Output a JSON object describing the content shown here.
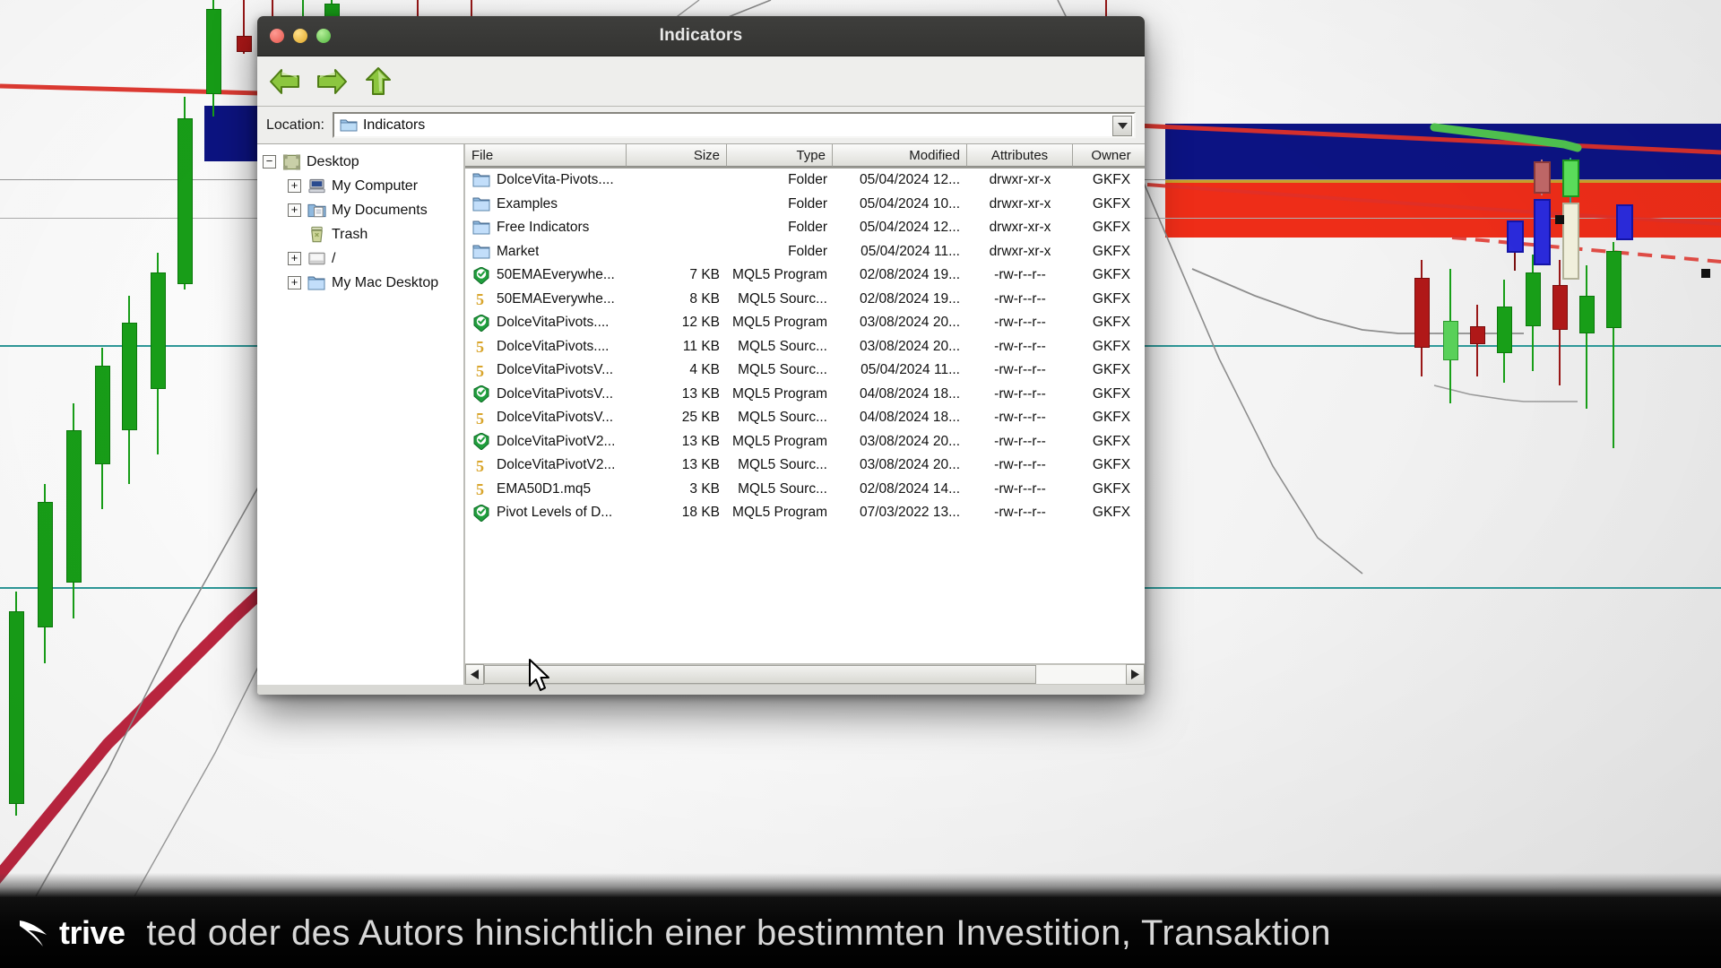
{
  "window": {
    "title": "Indicators",
    "traffic_lights": [
      "close",
      "minimize",
      "maximize"
    ]
  },
  "toolbar": {
    "back_label": "Back",
    "forward_label": "Forward",
    "up_label": "Up"
  },
  "location": {
    "label": "Location:",
    "value": "Indicators",
    "dropdown_glyph": "▼"
  },
  "tree": {
    "items": [
      {
        "label": "Desktop",
        "level": 0,
        "expander": "−",
        "icon": "desktop-icon"
      },
      {
        "label": "My Computer",
        "level": 1,
        "expander": "+",
        "icon": "computer-icon"
      },
      {
        "label": "My Documents",
        "level": 1,
        "expander": "+",
        "icon": "documents-icon"
      },
      {
        "label": "Trash",
        "level": 1,
        "expander": "",
        "icon": "trash-icon"
      },
      {
        "label": "/",
        "level": 1,
        "expander": "+",
        "icon": "drive-icon"
      },
      {
        "label": "My Mac Desktop",
        "level": 1,
        "expander": "+",
        "icon": "folder-icon"
      }
    ]
  },
  "filelist": {
    "columns": [
      "File",
      "Size",
      "Type",
      "Modified",
      "Attributes",
      "Owner"
    ],
    "rows": [
      {
        "name": "DolceVita-Pivots....",
        "size": "",
        "type": "Folder",
        "modified": "05/04/2024 12...",
        "attributes": "drwxr-xr-x",
        "owner": "GKFX",
        "icon": "folder-icon"
      },
      {
        "name": "Examples",
        "size": "",
        "type": "Folder",
        "modified": "05/04/2024 10...",
        "attributes": "drwxr-xr-x",
        "owner": "GKFX",
        "icon": "folder-icon"
      },
      {
        "name": "Free Indicators",
        "size": "",
        "type": "Folder",
        "modified": "05/04/2024 12...",
        "attributes": "drwxr-xr-x",
        "owner": "GKFX",
        "icon": "folder-icon"
      },
      {
        "name": "Market",
        "size": "",
        "type": "Folder",
        "modified": "05/04/2024 11...",
        "attributes": "drwxr-xr-x",
        "owner": "GKFX",
        "icon": "folder-icon"
      },
      {
        "name": "50EMAEverywhe...",
        "size": "7 KB",
        "type": "MQL5 Program",
        "modified": "02/08/2024 19...",
        "attributes": "-rw-r--r--",
        "owner": "GKFX",
        "icon": "mql5-program-icon"
      },
      {
        "name": "50EMAEverywhe...",
        "size": "8 KB",
        "type": "MQL5 Sourc...",
        "modified": "02/08/2024 19...",
        "attributes": "-rw-r--r--",
        "owner": "GKFX",
        "icon": "mql5-source-icon"
      },
      {
        "name": "DolceVitaPivots....",
        "size": "12 KB",
        "type": "MQL5 Program",
        "modified": "03/08/2024 20...",
        "attributes": "-rw-r--r--",
        "owner": "GKFX",
        "icon": "mql5-program-icon"
      },
      {
        "name": "DolceVitaPivots....",
        "size": "11 KB",
        "type": "MQL5 Sourc...",
        "modified": "03/08/2024 20...",
        "attributes": "-rw-r--r--",
        "owner": "GKFX",
        "icon": "mql5-source-icon"
      },
      {
        "name": "DolceVitaPivotsV...",
        "size": "4 KB",
        "type": "MQL5 Sourc...",
        "modified": "05/04/2024 11...",
        "attributes": "-rw-r--r--",
        "owner": "GKFX",
        "icon": "mql5-source-icon"
      },
      {
        "name": "DolceVitaPivotsV...",
        "size": "13 KB",
        "type": "MQL5 Program",
        "modified": "04/08/2024 18...",
        "attributes": "-rw-r--r--",
        "owner": "GKFX",
        "icon": "mql5-program-icon"
      },
      {
        "name": "DolceVitaPivotsV...",
        "size": "25 KB",
        "type": "MQL5 Sourc...",
        "modified": "04/08/2024 18...",
        "attributes": "-rw-r--r--",
        "owner": "GKFX",
        "icon": "mql5-source-icon"
      },
      {
        "name": "DolceVitaPivotV2...",
        "size": "13 KB",
        "type": "MQL5 Program",
        "modified": "03/08/2024 20...",
        "attributes": "-rw-r--r--",
        "owner": "GKFX",
        "icon": "mql5-program-icon"
      },
      {
        "name": "DolceVitaPivotV2...",
        "size": "13 KB",
        "type": "MQL5 Sourc...",
        "modified": "03/08/2024 20...",
        "attributes": "-rw-r--r--",
        "owner": "GKFX",
        "icon": "mql5-source-icon"
      },
      {
        "name": "EMA50D1.mq5",
        "size": "3 KB",
        "type": "MQL5 Sourc...",
        "modified": "02/08/2024 14...",
        "attributes": "-rw-r--r--",
        "owner": "GKFX",
        "icon": "mql5-source-icon"
      },
      {
        "name": "Pivot Levels of D...",
        "size": "18 KB",
        "type": "MQL5 Program",
        "modified": "07/03/2022 13...",
        "attributes": "-rw-r--r--",
        "owner": "GKFX",
        "icon": "mql5-program-icon"
      }
    ]
  },
  "scrollbar": {
    "left_glyph": "◀",
    "right_glyph": "▶"
  },
  "banner": {
    "brand": "trive",
    "text": "ted oder des Autors hinsichtlich einer bestimmten Investition, Transaktion"
  },
  "colors": {
    "titlebar": "#373735",
    "accent_red": "#e8201a",
    "accent_blue": "#0c1383",
    "bull_green": "#18a018",
    "bear_red": "#b01818",
    "ma_red": "#b81430",
    "teal": "#2f9a9a"
  }
}
